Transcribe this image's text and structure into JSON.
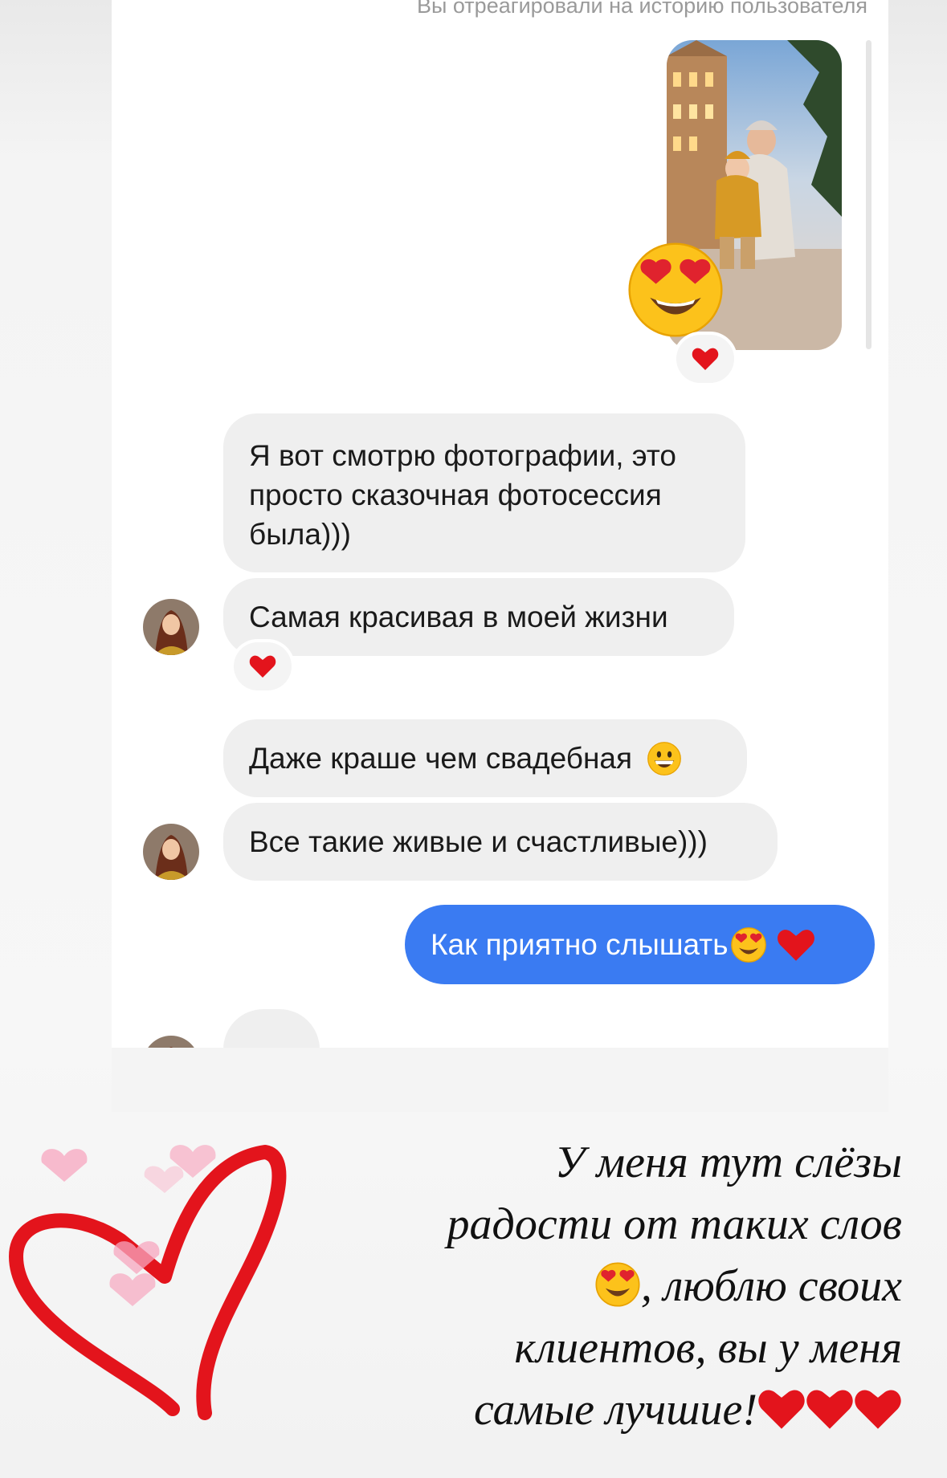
{
  "chat": {
    "story_reaction_caption": "Вы отреагировали на историю пользователя",
    "story_thumbnail_icon": "story-photo-thumbnail",
    "story_reaction_emoji_icon": "heart-eyes-emoji",
    "messages": [
      {
        "from": "contact",
        "text_lines": [
          "Я вот смотрю фотографии, это",
          "просто сказочная фотосессия",
          "была)))"
        ]
      },
      {
        "from": "contact",
        "text": "Самая красивая в моей жизни",
        "reaction_icon": "red-heart"
      },
      {
        "from": "contact",
        "text": "Даже краше чем свадебная",
        "trailing_emoji_icon": "grinning-face-emoji"
      },
      {
        "from": "contact",
        "text": "Все такие живые и счастливые)))"
      },
      {
        "from": "me",
        "text": "Как приятно слышать",
        "trailing_icons": [
          "heart-eyes-emoji",
          "red-heart"
        ]
      }
    ]
  },
  "story_overlay": {
    "text_lines": [
      "У меня тут слёзы",
      "радости от таких слов",
      ", люблю своих",
      "клиентов, вы у меня",
      "самые лучшие!"
    ],
    "decorative_icon": "hand-drawn-red-heart",
    "accent_colors": {
      "heart_red": "#e3141c",
      "bubble_blue": "#3a7bf2",
      "bubble_gray": "#efefef"
    }
  }
}
